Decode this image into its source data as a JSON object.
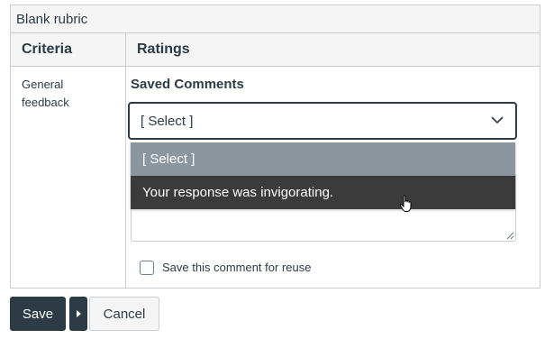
{
  "rubric": {
    "title": "Blank rubric",
    "columns": {
      "criteria": "Criteria",
      "ratings": "Ratings"
    },
    "criterion": {
      "description": "General feedback"
    }
  },
  "saved_comments": {
    "label": "Saved Comments",
    "selected": "[ Select ]",
    "options": [
      "[ Select ]",
      "Your response was invigorating."
    ],
    "highlighted_index": 1
  },
  "comment_box": {
    "value": ""
  },
  "reuse": {
    "label": "Save this comment for reuse",
    "checked": false
  },
  "actions": {
    "save_label": "Save",
    "cancel_label": "Cancel"
  },
  "colors": {
    "primary_button": "#2d3b45",
    "option_selected_bg": "#8b969e",
    "option_hover_bg": "#3b3b3b",
    "border": "#c7cdd1"
  },
  "icons": {
    "select_toggle": "chevron-down-icon",
    "split_menu": "caret-right-icon",
    "cursor": "hand-pointer-icon"
  }
}
